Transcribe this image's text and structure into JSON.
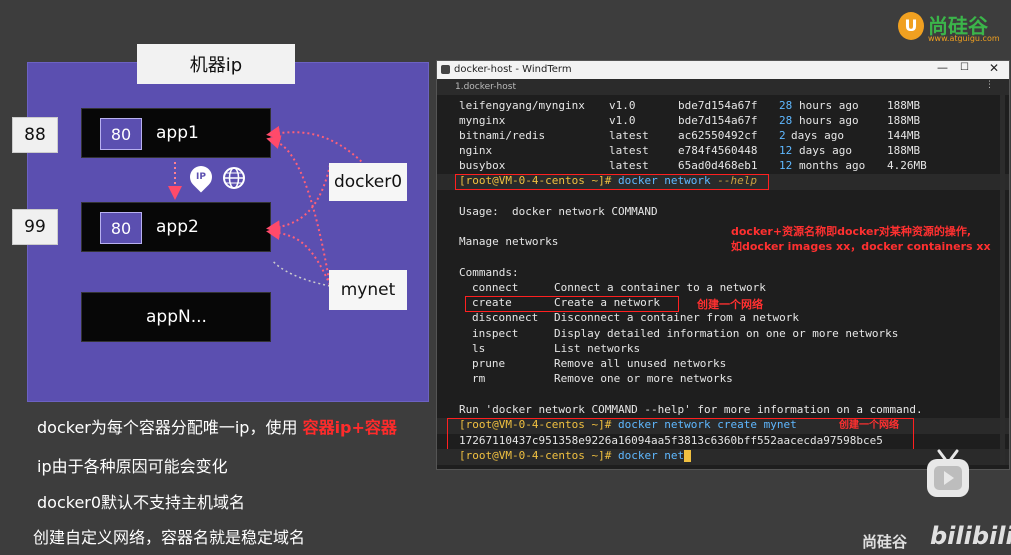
{
  "brand": {
    "name": "尚硅谷",
    "url": "www.atguigu.com",
    "footer": "尚硅谷",
    "platform": "bilibili"
  },
  "diagram": {
    "title": "机器ip",
    "host_ports": [
      "88",
      "99"
    ],
    "apps": [
      {
        "port": "80",
        "name": "app1"
      },
      {
        "port": "80",
        "name": "app2"
      },
      {
        "name": "appN..."
      }
    ],
    "networks": [
      "docker0",
      "mynet"
    ]
  },
  "notes": {
    "line1_prefix": "docker为每个容器分配唯一ip，使用 ",
    "line1_highlight": "容器ip+容器",
    "line2": "ip由于各种原因可能会变化",
    "line3": "docker0默认不支持主机域名",
    "line4": "创建自定义网络，容器名就是稳定域名"
  },
  "window": {
    "title": "docker-host - WindTerm",
    "tab": "1.docker-host",
    "image_rows": [
      {
        "repo": "leifengyang/mynginx",
        "tag": "v1.0",
        "id": "bde7d154a67f",
        "n": "28",
        "unit": "hours ago",
        "size": "188MB"
      },
      {
        "repo": "mynginx",
        "tag": "v1.0",
        "id": "bde7d154a67f",
        "n": "28",
        "unit": "hours ago",
        "size": "188MB"
      },
      {
        "repo": "bitnami/redis",
        "tag": "latest",
        "id": "ac62550492cf",
        "n": "2",
        "unit": "days ago",
        "size": "144MB"
      },
      {
        "repo": "nginx",
        "tag": "latest",
        "id": "e784f4560448",
        "n": "12",
        "unit": "days ago",
        "size": "188MB"
      },
      {
        "repo": "busybox",
        "tag": "latest",
        "id": "65ad0d468eb1",
        "n": "12",
        "unit": "months ago",
        "size": "4.26MB"
      }
    ],
    "prompt": "[root@VM-0-4-centos ~]#",
    "cmd1": {
      "main": "docker network",
      "flag": "--help"
    },
    "usage": "Usage:  docker network COMMAND",
    "manage": "Manage networks",
    "commands_header": "Commands:",
    "commands": [
      {
        "name": "connect",
        "desc": "Connect a container to a network"
      },
      {
        "name": "create",
        "desc": "Create a network"
      },
      {
        "name": "disconnect",
        "desc": "Disconnect a container from a network"
      },
      {
        "name": "inspect",
        "desc": "Display detailed information on one or more networks"
      },
      {
        "name": "ls",
        "desc": "List networks"
      },
      {
        "name": "prune",
        "desc": "Remove all unused networks"
      },
      {
        "name": "rm",
        "desc": "Remove one or more networks"
      }
    ],
    "run_help": "Run 'docker network COMMAND --help' for more information on a command.",
    "cmd2": "docker network create mynet",
    "network_id": "17267110437c951358e9226a16094aa5f3813c6360bff552aacecda97598bce5",
    "cmd3": "docker net"
  },
  "annotations": {
    "note1_line1": "docker+资源名称即docker对某种资源的操作,",
    "note1_line2": "如docker images xx，docker containers xx",
    "create_note": "创建一个网络",
    "create_note2": "创建一个网络"
  }
}
